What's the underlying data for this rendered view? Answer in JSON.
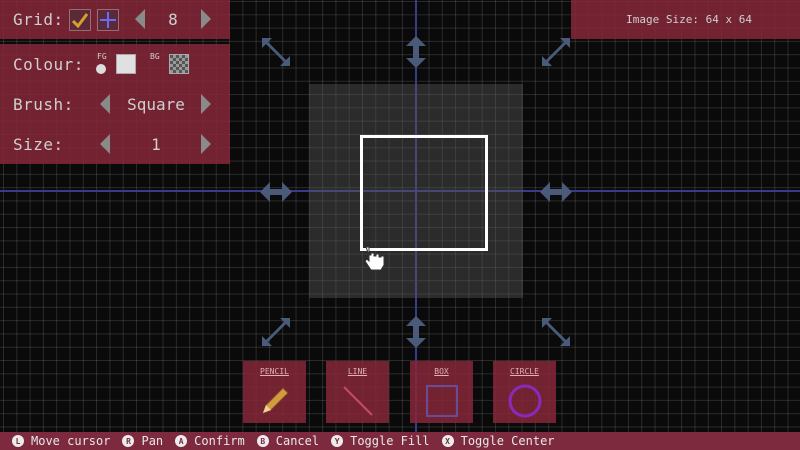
{
  "grid_panel": {
    "label": "Grid:",
    "value": "8",
    "check_icon": "checkmark-icon",
    "grid_icon": "grid-icon"
  },
  "colour_panel": {
    "label": "Colour:",
    "fg_label": "FG",
    "bg_label": "BG"
  },
  "brush_panel": {
    "label": "Brush:",
    "value": "Square"
  },
  "size_panel": {
    "label": "Size:",
    "value": "1"
  },
  "image_size": "Image Size: 64 x 64",
  "tools": [
    {
      "name": "PENCIL",
      "icon": "pencil-icon"
    },
    {
      "name": "LINE",
      "icon": "line-icon"
    },
    {
      "name": "BOX",
      "icon": "box-icon"
    },
    {
      "name": "CIRCLE",
      "icon": "circle-icon"
    }
  ],
  "hints": [
    {
      "button": "L",
      "label": "Move cursor"
    },
    {
      "button": "R",
      "label": "Pan"
    },
    {
      "button": "A",
      "label": "Confirm"
    },
    {
      "button": "B",
      "label": "Cancel"
    },
    {
      "button": "Y",
      "label": "Toggle Fill"
    },
    {
      "button": "X",
      "label": "Toggle Center"
    }
  ],
  "colors": {
    "panel": "#86273a",
    "bar": "#7d2a3f",
    "axis": "#3a3a8a"
  }
}
